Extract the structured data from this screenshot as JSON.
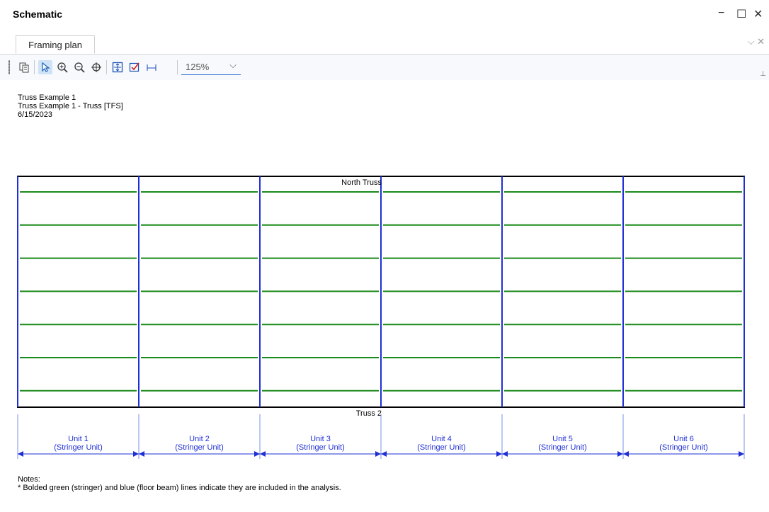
{
  "window": {
    "title": "Schematic"
  },
  "window_controls": {
    "minimize": "−",
    "maximize": "☐",
    "close": "✕"
  },
  "tab": {
    "label": "Framing plan"
  },
  "tab_controls": {
    "dropdown": "⌵",
    "close": "✕"
  },
  "toolbar": {
    "zoom_value": "125%",
    "buttons": [
      "copy-icon",
      "select-pointer-icon",
      "zoom-in-icon",
      "zoom-out-icon",
      "pan-icon",
      "fit-to-window-icon",
      "check-icon",
      "dimension-icon"
    ]
  },
  "header": {
    "line1": "Truss Example 1",
    "line2": "Truss Example 1 - Truss [TFS]",
    "line3": "6/15/2023"
  },
  "plan": {
    "north_label": "North Truss",
    "south_label": "Truss 2",
    "stringer_count": 7,
    "colors": {
      "stringer": "#1a8a1a",
      "floor_beam": "#1f2fd6",
      "outline": "#000000"
    }
  },
  "units": [
    {
      "name": "Unit 1",
      "type": "(Stringer Unit)"
    },
    {
      "name": "Unit 2",
      "type": "(Stringer Unit)"
    },
    {
      "name": "Unit 3",
      "type": "(Stringer Unit)"
    },
    {
      "name": "Unit 4",
      "type": "(Stringer Unit)"
    },
    {
      "name": "Unit 5",
      "type": "(Stringer Unit)"
    },
    {
      "name": "Unit 6",
      "type": "(Stringer Unit)"
    }
  ],
  "notes": {
    "heading": "Notes:",
    "line1": "* Bolded green (stringer) and blue (floor beam) lines indicate they are included in the analysis."
  }
}
